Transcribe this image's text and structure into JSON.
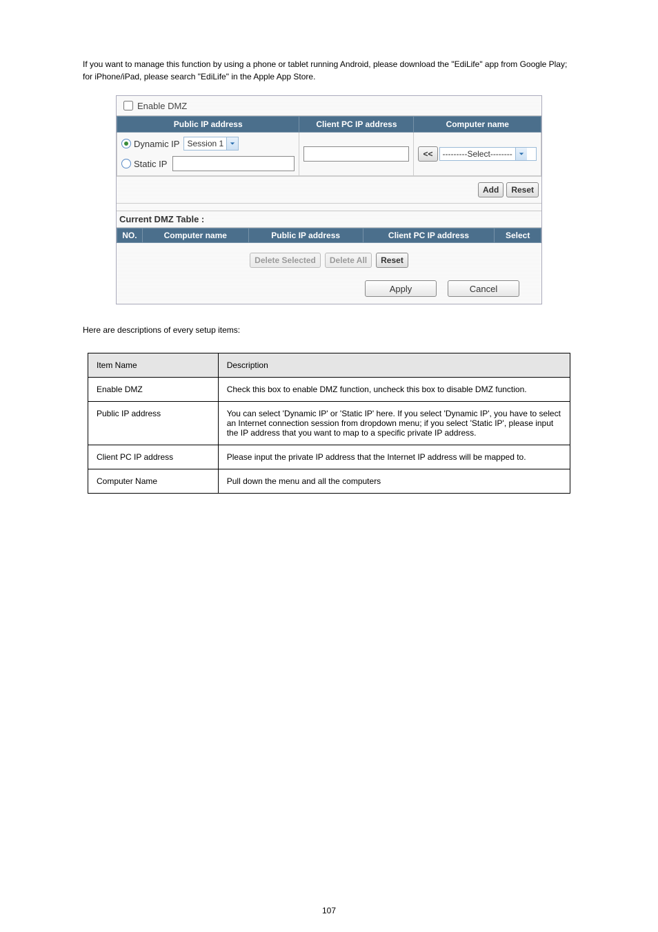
{
  "intro": "If you want to manage this function by using a phone or tablet running Android, please download the \"EdiLife\" app from Google Play; for iPhone/iPad, please search \"EdiLife\" in the Apple App Store.",
  "panel": {
    "enable_label": "Enable DMZ",
    "headers": {
      "public_ip": "Public IP address",
      "client_ip": "Client PC IP address",
      "computer_name": "Computer name"
    },
    "public_ip_cell": {
      "dynamic_label": "Dynamic IP",
      "dynamic_selected": true,
      "session_select": "Session 1",
      "static_label": "Static IP",
      "static_selected": false
    },
    "computer_cell": {
      "insert_label": "<<",
      "select_placeholder": "---------Select--------"
    },
    "add_label": "Add",
    "reset_label": "Reset",
    "table_title": "Current DMZ Table :",
    "list_headers": {
      "no": "NO.",
      "computer_name": "Computer name",
      "public_ip": "Public IP address",
      "client_ip": "Client PC IP address",
      "select": "Select"
    },
    "delete_selected_label": "Delete Selected",
    "delete_all_label": "Delete All",
    "reset2_label": "Reset",
    "apply_label": "Apply",
    "cancel_label": "Cancel"
  },
  "desc": "Here are descriptions of every setup items:",
  "info": {
    "head_item": "Item Name",
    "head_desc": "Description",
    "rows": [
      {
        "name": "Enable DMZ",
        "desc": "Check this box to enable DMZ function, uncheck this box to disable DMZ function."
      },
      {
        "name": "Public IP address",
        "desc": "You can select 'Dynamic IP' or 'Static IP' here. If you select 'Dynamic IP', you have to select an Internet connection session from dropdown menu; if you select 'Static IP', please input the IP address that you want to map to a specific private IP address."
      },
      {
        "name": "Client PC IP address",
        "desc": "Please input the private IP address that the Internet IP address will be mapped to."
      },
      {
        "name": "Computer Name",
        "desc": "Pull down the menu and all the computers"
      }
    ]
  },
  "page_number": "107"
}
